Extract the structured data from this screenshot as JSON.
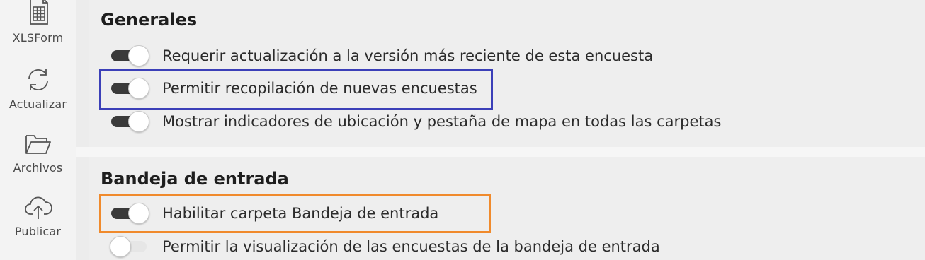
{
  "sidebar": {
    "items": [
      {
        "label": "XLSForm",
        "icon": "spreadsheet-icon"
      },
      {
        "label": "Actualizar",
        "icon": "refresh-icon"
      },
      {
        "label": "Archivos",
        "icon": "folder-icon"
      },
      {
        "label": "Publicar",
        "icon": "cloud-upload-icon"
      }
    ]
  },
  "general": {
    "title": "Generales",
    "options": [
      {
        "label": "Requerir actualización a la versión más reciente de esta encuesta",
        "enabled": true
      },
      {
        "label": "Permitir recopilación de nuevas encuestas",
        "enabled": true
      },
      {
        "label": "Mostrar indicadores de ubicación y pestaña de mapa en todas las carpetas",
        "enabled": true
      }
    ]
  },
  "inbox": {
    "title": "Bandeja de entrada",
    "options": [
      {
        "label": "Habilitar carpeta Bandeja de entrada",
        "enabled": true
      },
      {
        "label": "Permitir la visualización de las encuestas de la bandeja de entrada",
        "enabled": false
      }
    ]
  },
  "colors": {
    "highlight_blue": "#3b3fb8",
    "highlight_orange": "#f08a2c",
    "toggle_on": "#3a3a3a",
    "toggle_off": "#e6e6e6"
  }
}
